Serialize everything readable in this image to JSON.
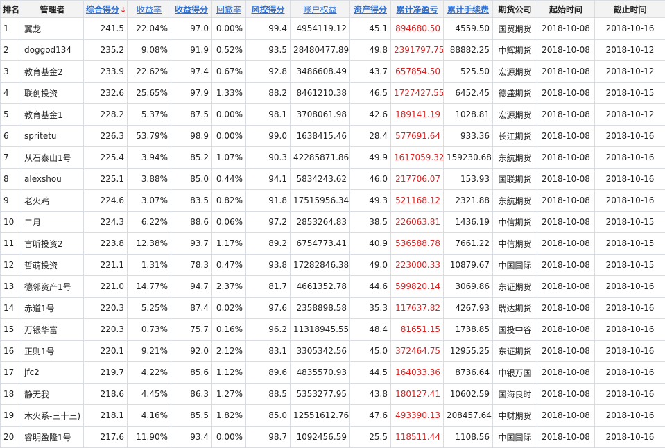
{
  "columns": [
    {
      "key": "rank",
      "label": "排名",
      "sortable": false
    },
    {
      "key": "manager",
      "label": "管理者",
      "sortable": false
    },
    {
      "key": "score",
      "label": "综合得分",
      "sortable": true,
      "sorted": true,
      "sort_dir_icon": "↓"
    },
    {
      "key": "return",
      "label": "收益率",
      "sortable": true
    },
    {
      "key": "return_score",
      "label": "收益得分",
      "sortable": true
    },
    {
      "key": "drawdown",
      "label": "回撤率",
      "sortable": true
    },
    {
      "key": "risk_score",
      "label": "风控得分",
      "sortable": true
    },
    {
      "key": "equity",
      "label": "账户权益",
      "sortable": true
    },
    {
      "key": "asset_score",
      "label": "资产得分",
      "sortable": true
    },
    {
      "key": "net_pnl",
      "label": "累计净盈亏",
      "sortable": true
    },
    {
      "key": "fees",
      "label": "累计手续费",
      "sortable": true
    },
    {
      "key": "broker",
      "label": "期货公司",
      "sortable": false
    },
    {
      "key": "start",
      "label": "起始时间",
      "sortable": false
    },
    {
      "key": "end",
      "label": "截止时间",
      "sortable": false
    }
  ],
  "rows": [
    [
      "1",
      "翼龙",
      "241.5",
      "22.04%",
      "97.0",
      "0.00%",
      "99.4",
      "4954119.12",
      "45.1",
      "894680.50",
      "4559.50",
      "国贸期货",
      "2018-10-08",
      "2018-10-16"
    ],
    [
      "2",
      "doggod134",
      "235.2",
      "9.08%",
      "91.9",
      "0.52%",
      "93.5",
      "28480477.89",
      "49.8",
      "2391797.75",
      "88882.25",
      "中辉期货",
      "2018-10-08",
      "2018-10-12"
    ],
    [
      "3",
      "教育基金2",
      "233.9",
      "22.62%",
      "97.4",
      "0.67%",
      "92.8",
      "3486608.49",
      "43.7",
      "657854.50",
      "525.50",
      "宏源期货",
      "2018-10-08",
      "2018-10-12"
    ],
    [
      "4",
      "联创投资",
      "232.6",
      "25.65%",
      "97.9",
      "1.33%",
      "88.2",
      "8461210.38",
      "46.5",
      "1727427.55",
      "6452.45",
      "德盛期货",
      "2018-10-08",
      "2018-10-15"
    ],
    [
      "5",
      "教育基金1",
      "228.2",
      "5.37%",
      "87.5",
      "0.00%",
      "98.1",
      "3708061.98",
      "42.6",
      "189141.19",
      "1028.81",
      "宏源期货",
      "2018-10-08",
      "2018-10-12"
    ],
    [
      "6",
      "spritetu",
      "226.3",
      "53.79%",
      "98.9",
      "0.00%",
      "99.0",
      "1638415.46",
      "28.4",
      "577691.64",
      "933.36",
      "长江期货",
      "2018-10-08",
      "2018-10-16"
    ],
    [
      "7",
      "从石泰山1号",
      "225.4",
      "3.94%",
      "85.2",
      "1.07%",
      "90.3",
      "42285871.86",
      "49.9",
      "1617059.32",
      "159230.68",
      "东航期货",
      "2018-10-08",
      "2018-10-16"
    ],
    [
      "8",
      "alexshou",
      "225.1",
      "3.88%",
      "85.0",
      "0.44%",
      "94.1",
      "5834243.62",
      "46.0",
      "217706.07",
      "153.93",
      "国联期货",
      "2018-10-08",
      "2018-10-16"
    ],
    [
      "9",
      "老火鸡",
      "224.6",
      "3.07%",
      "83.5",
      "0.82%",
      "91.8",
      "17515956.34",
      "49.3",
      "521168.12",
      "2321.88",
      "东航期货",
      "2018-10-08",
      "2018-10-16"
    ],
    [
      "10",
      "二月",
      "224.3",
      "6.22%",
      "88.6",
      "0.06%",
      "97.2",
      "2853264.83",
      "38.5",
      "226063.81",
      "1436.19",
      "中信期货",
      "2018-10-08",
      "2018-10-15"
    ],
    [
      "11",
      "言昕投资2",
      "223.8",
      "12.38%",
      "93.7",
      "1.17%",
      "89.2",
      "6754773.41",
      "40.9",
      "536588.78",
      "7661.22",
      "中信期货",
      "2018-10-08",
      "2018-10-15"
    ],
    [
      "12",
      "哲萌投资",
      "221.1",
      "1.31%",
      "78.3",
      "0.47%",
      "93.8",
      "17282846.38",
      "49.0",
      "223000.33",
      "10879.67",
      "中国国际",
      "2018-10-08",
      "2018-10-15"
    ],
    [
      "13",
      "德邻资产1号",
      "221.0",
      "14.77%",
      "94.7",
      "2.37%",
      "81.7",
      "4661352.78",
      "44.6",
      "599820.14",
      "3069.86",
      "东证期货",
      "2018-10-08",
      "2018-10-16"
    ],
    [
      "14",
      "赤道1号",
      "220.3",
      "5.25%",
      "87.4",
      "0.02%",
      "97.6",
      "2358898.58",
      "35.3",
      "117637.82",
      "4267.93",
      "瑞达期货",
      "2018-10-08",
      "2018-10-16"
    ],
    [
      "15",
      "万银华富",
      "220.3",
      "0.73%",
      "75.7",
      "0.16%",
      "96.2",
      "11318945.55",
      "48.4",
      "81651.15",
      "1738.85",
      "国投中谷",
      "2018-10-08",
      "2018-10-16"
    ],
    [
      "16",
      "正则1号",
      "220.1",
      "9.21%",
      "92.0",
      "2.12%",
      "83.1",
      "3305342.56",
      "45.0",
      "372464.75",
      "12955.25",
      "东证期货",
      "2018-10-08",
      "2018-10-16"
    ],
    [
      "17",
      "jfc2",
      "219.7",
      "4.22%",
      "85.6",
      "1.12%",
      "89.6",
      "4835570.93",
      "44.5",
      "164033.36",
      "8736.64",
      "申银万国",
      "2018-10-08",
      "2018-10-16"
    ],
    [
      "18",
      "静无我",
      "218.6",
      "4.45%",
      "86.3",
      "1.27%",
      "88.5",
      "5353277.95",
      "43.8",
      "180127.41",
      "10602.59",
      "国海良时",
      "2018-10-08",
      "2018-10-16"
    ],
    [
      "19",
      "木火系-三十三)",
      "218.1",
      "4.16%",
      "85.5",
      "1.82%",
      "85.0",
      "12551612.76",
      "47.6",
      "493390.13",
      "208457.64",
      "中财期货",
      "2018-10-08",
      "2018-10-16"
    ],
    [
      "20",
      "睿明盈隆1号",
      "217.6",
      "11.90%",
      "93.4",
      "0.00%",
      "98.7",
      "1092456.59",
      "25.5",
      "118511.44",
      "1108.56",
      "中国国际",
      "2018-10-08",
      "2018-10-16"
    ]
  ],
  "colors": {
    "link": "#2f6fd0",
    "pnl": "#e02020",
    "header_bg": "#f3f3f3",
    "border": "#d9dde3"
  }
}
